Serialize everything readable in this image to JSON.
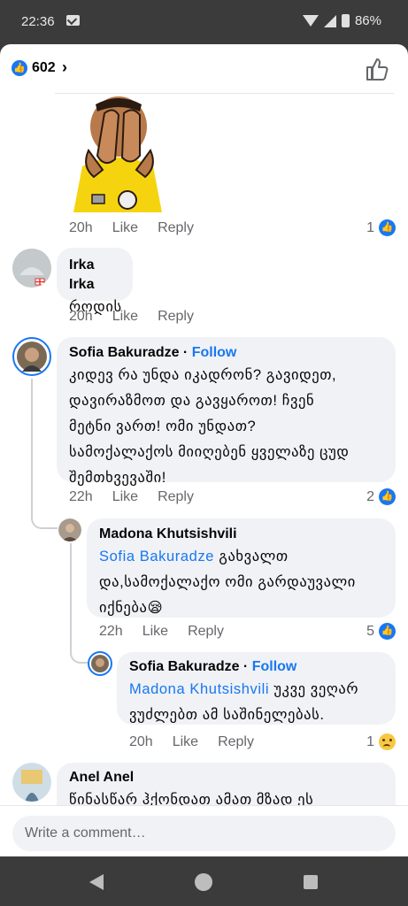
{
  "status": {
    "time": "22:36",
    "battery": "86%"
  },
  "reactions": {
    "count": "602"
  },
  "comments": [
    {
      "time": "20h",
      "like": "Like",
      "reply": "Reply",
      "likes": "1"
    },
    {
      "author": "Irka Irka",
      "text": "როდის",
      "time": "20h",
      "like": "Like",
      "reply": "Reply"
    },
    {
      "author": "Sofia Bakuradze",
      "follow": "Follow",
      "lines": [
        "კიდევ რა უნდა იკადრონ? გავიდეთ,",
        "დავირაზმოთ და გავყაროთ! ჩვენ",
        "მეტნი ვართ! ომი უნდათ?",
        "სამოქალაქოს მიიღებენ ყველაზე ცუდ",
        "შემთხვევაში!"
      ],
      "time": "22h",
      "like": "Like",
      "reply": "Reply",
      "likes": "2"
    },
    {
      "author": "Madona Khutsishvili",
      "mention": "Sofia Bakuradze",
      "line1_rest": " გახვალთ",
      "lines": [
        "და,სამოქალაქო ომი გარდაუვალი",
        "იქნება😪"
      ],
      "time": "22h",
      "like": "Like",
      "reply": "Reply",
      "likes": "5"
    },
    {
      "author": "Sofia Bakuradze",
      "follow": "Follow",
      "mention": "Madona Khutsishvili",
      "line1_rest": " უკვე ვეღარ",
      "lines": [
        "ვუძლებთ ამ საშინელებას."
      ],
      "time": "20h",
      "like": "Like",
      "reply": "Reply",
      "likes": "1"
    },
    {
      "author": "Anel Anel",
      "text": "წინასწარ ჰქონდათ ამათ მზად ეს"
    }
  ],
  "composer": {
    "placeholder": "Write a comment…"
  },
  "colors": {
    "accent": "#1877f2",
    "bubble": "#f0f2f5",
    "meta": "#65676b"
  }
}
